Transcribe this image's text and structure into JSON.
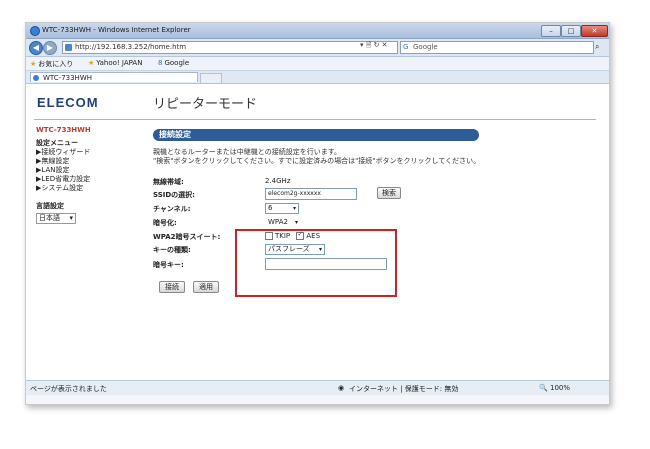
{
  "window": {
    "title": "WTC-733HWH - Windows Internet Explorer",
    "minimize": "–",
    "maximize": "□",
    "close": "✕"
  },
  "browser": {
    "back": "◀",
    "forward": "▶",
    "url": "http://192.168.3.252/home.htm",
    "url_buttons": "▾  🗎  ↻  ✕",
    "search_placeholder": "Google",
    "search_go": "⌕",
    "favorites_label": "お気に入り",
    "favorites": [
      "Yahoo! JAPAN",
      "Google"
    ],
    "tab_label": "WTC-733HWH"
  },
  "page": {
    "logo": "ELECOM",
    "title": "リピーターモード",
    "sidebar": {
      "device": "WTC-733HWH",
      "settings_menu": "設定メニュー",
      "items": [
        "▶接続ウィザード",
        "▶無線設定",
        "▶LAN設定",
        "▶LED省電力設定",
        "▶システム設定"
      ],
      "language_label": "言語設定",
      "language_value": "日本語"
    },
    "panel": {
      "heading": "接続設定",
      "description_1": "親機となるルーターまたは中継機との接続設定を行います。",
      "description_2": "\"検索\"ボタンをクリックしてください。すでに設定済みの場合は\"接続\"ボタンをクリックしてください。",
      "band_label": "無線帯域:",
      "band_value": "2.4GHz",
      "ssid_label": "SSIDの選択:",
      "ssid_value": "elecom2g-xxxxxx",
      "search_button": "検索",
      "channel_label": "チャンネル:",
      "channel_value": "6",
      "encryption_label": "暗号化:",
      "encryption_value": "WPA2",
      "suite_label": "WPA2暗号スイート:",
      "suite_tkip": "TKIP",
      "suite_aes": "AES",
      "keytype_label": "キーの種類:",
      "keytype_value": "パスフレーズ",
      "key_label": "暗号キー:",
      "key_value": "",
      "connect_button": "接続",
      "apply_button": "適用"
    }
  },
  "status": {
    "left": "ページが表示されました",
    "zone": "インターネット | 保護モード: 無効",
    "zoom": "100%"
  }
}
